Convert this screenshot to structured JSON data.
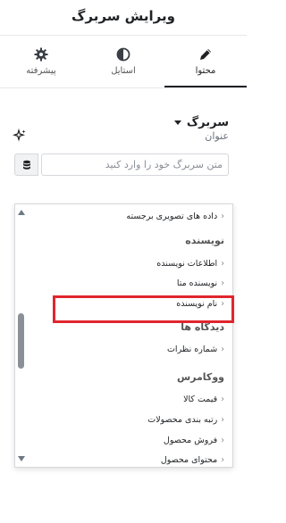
{
  "header": {
    "title": "ویرایش سربرگ"
  },
  "tabs": [
    {
      "label": "پیشرفته",
      "icon": "gear-icon",
      "active": false
    },
    {
      "label": "استایل",
      "icon": "half-circle-icon",
      "active": false
    },
    {
      "label": "محتوا",
      "icon": "pencil-icon",
      "active": true
    }
  ],
  "section": {
    "title": "سربرگ"
  },
  "field": {
    "label": "عنوان",
    "placeholder": "متن سربرگ خود را وارد کنید"
  },
  "dropdown": {
    "items": [
      {
        "kind": "option",
        "label": "داده های تصویری برجسته"
      },
      {
        "kind": "group",
        "label": "نویسنده"
      },
      {
        "kind": "option",
        "label": "اطلاعات نویسنده"
      },
      {
        "kind": "option",
        "label": "نویسنده متا"
      },
      {
        "kind": "option",
        "label": "نام نویسنده"
      },
      {
        "kind": "group",
        "label": "دیدگاه ها"
      },
      {
        "kind": "option",
        "label": "شماره نظرات"
      },
      {
        "kind": "group",
        "label": "ووکامرس"
      },
      {
        "kind": "option",
        "label": "قیمت کالا"
      },
      {
        "kind": "option",
        "label": "رتبه بندی محصولات"
      },
      {
        "kind": "option",
        "label": "فروش محصول"
      },
      {
        "kind": "option",
        "label": "محتوای محصول"
      }
    ]
  },
  "highlight_color": "#e0262e"
}
